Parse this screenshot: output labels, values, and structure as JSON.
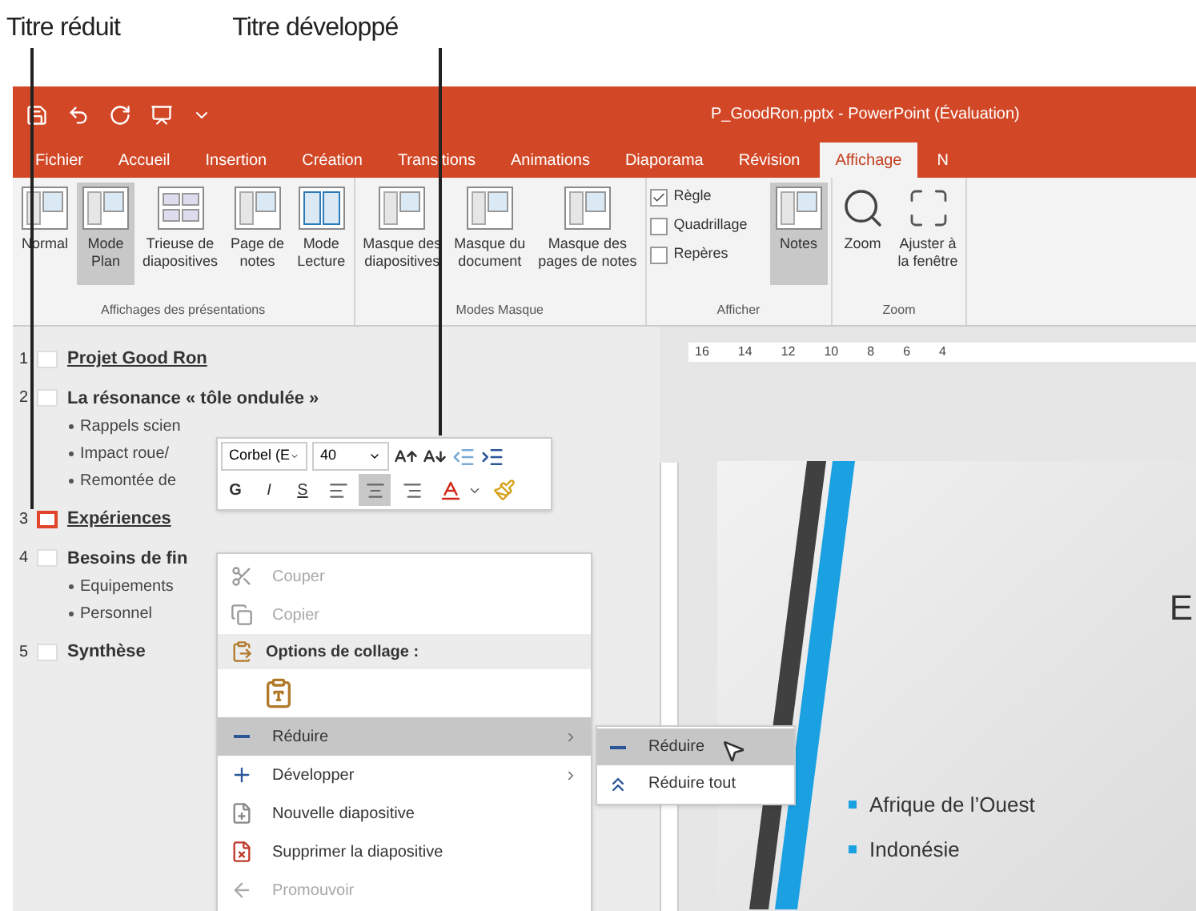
{
  "callouts": [
    {
      "label": "Titre réduit"
    },
    {
      "label": "Titre développé"
    }
  ],
  "window": {
    "title": "P_GoodRon.pptx - PowerPoint (Évaluation)"
  },
  "tabs": [
    {
      "label": "Fichier",
      "selected": false
    },
    {
      "label": "Accueil",
      "selected": false
    },
    {
      "label": "Insertion",
      "selected": false
    },
    {
      "label": "Création",
      "selected": false
    },
    {
      "label": "Transitions",
      "selected": false
    },
    {
      "label": "Animations",
      "selected": false
    },
    {
      "label": "Diaporama",
      "selected": false
    },
    {
      "label": "Révision",
      "selected": false
    },
    {
      "label": "Affichage",
      "selected": true
    },
    {
      "label": "N",
      "selected": false
    }
  ],
  "ribbon": {
    "groups": [
      {
        "label": "Affichages des présentations",
        "items": [
          {
            "kind": "large",
            "lines": [
              "Normal"
            ],
            "selected": false
          },
          {
            "kind": "large",
            "lines": [
              "Mode",
              "Plan"
            ],
            "selected": true
          },
          {
            "kind": "large",
            "lines": [
              "Trieuse de",
              "diapositives"
            ],
            "selected": false
          },
          {
            "kind": "large",
            "lines": [
              "Page de",
              "notes"
            ],
            "selected": false
          },
          {
            "kind": "large",
            "lines": [
              "Mode",
              "Lecture"
            ],
            "selected": false
          }
        ]
      },
      {
        "label": "Modes Masque",
        "items": [
          {
            "kind": "large",
            "lines": [
              "Masque des",
              "diapositives"
            ],
            "selected": false
          },
          {
            "kind": "large",
            "lines": [
              "Masque du",
              "document"
            ],
            "selected": false
          },
          {
            "kind": "large",
            "lines": [
              "Masque des",
              "pages de notes"
            ],
            "selected": false
          }
        ]
      },
      {
        "label": "Afficher",
        "items": [
          {
            "kind": "checkbox",
            "lines": [
              "Règle"
            ],
            "checked": true
          },
          {
            "kind": "checkbox",
            "lines": [
              "Quadrillage"
            ],
            "checked": false
          },
          {
            "kind": "checkbox",
            "lines": [
              "Repères"
            ],
            "checked": false
          },
          {
            "kind": "large",
            "lines": [
              "Notes"
            ],
            "selected": true
          }
        ]
      },
      {
        "label": "Zoom",
        "items": [
          {
            "kind": "large",
            "lines": [
              "Zoom"
            ],
            "selected": false
          },
          {
            "kind": "large",
            "lines": [
              "Ajuster à",
              "la fenêtre"
            ],
            "selected": false
          }
        ]
      }
    ]
  },
  "outline": [
    {
      "number": "1",
      "title": "Projet Good Ron",
      "selected": false
    },
    {
      "number": "2",
      "title": "La résonance « tôle ondulée »",
      "selected": false,
      "children": [
        {
          "title": "Rappels scien"
        },
        {
          "title": "Impact roue/"
        },
        {
          "title": "Remontée de"
        }
      ]
    },
    {
      "number": "3",
      "title": "Expériences",
      "selected": true
    },
    {
      "number": "4",
      "title": "Besoins de fin",
      "selected": false,
      "children": [
        {
          "title": "Equipements"
        },
        {
          "title": "Personnel"
        }
      ]
    },
    {
      "number": "5",
      "title": "Synthèse",
      "selected": false
    }
  ],
  "ruler": {
    "labels": [
      "16",
      "14",
      "12",
      "10",
      "8",
      "6",
      "4"
    ]
  },
  "slide": {
    "title": "E",
    "bullets": [
      "Afrique de l’Ouest",
      "Indonésie"
    ]
  },
  "mini_toolbar": {
    "font": "Corbel (E",
    "size": "40",
    "format_buttons": [
      {
        "label": "G",
        "selected": false
      },
      {
        "label": "I",
        "selected": false
      },
      {
        "label": "S",
        "selected": false
      }
    ],
    "alignments": [
      {
        "selected": false
      },
      {
        "selected": true
      },
      {
        "selected": false
      }
    ]
  },
  "context_menu": {
    "items": [
      {
        "kind": "item",
        "label": "Couper",
        "disabled": true,
        "selected": false,
        "submenu": false
      },
      {
        "kind": "item",
        "label": "Copier",
        "disabled": true,
        "selected": false,
        "submenu": false
      },
      {
        "kind": "header",
        "label": "Options de collage :"
      },
      {
        "kind": "paste"
      },
      {
        "kind": "item",
        "label": "Réduire",
        "disabled": false,
        "selected": true,
        "submenu": true
      },
      {
        "kind": "item",
        "label": "Développer",
        "disabled": false,
        "selected": false,
        "submenu": true
      },
      {
        "kind": "item",
        "label": "Nouvelle diapositive",
        "disabled": false,
        "selected": false,
        "submenu": false
      },
      {
        "kind": "item",
        "label": "Supprimer la diapositive",
        "disabled": false,
        "selected": false,
        "submenu": false
      },
      {
        "kind": "item",
        "label": "Promouvoir",
        "disabled": true,
        "selected": false,
        "submenu": false
      }
    ]
  },
  "submenu": {
    "items": [
      {
        "label": "Réduire",
        "selected": true
      },
      {
        "label": "Réduire tout",
        "selected": false
      }
    ]
  }
}
